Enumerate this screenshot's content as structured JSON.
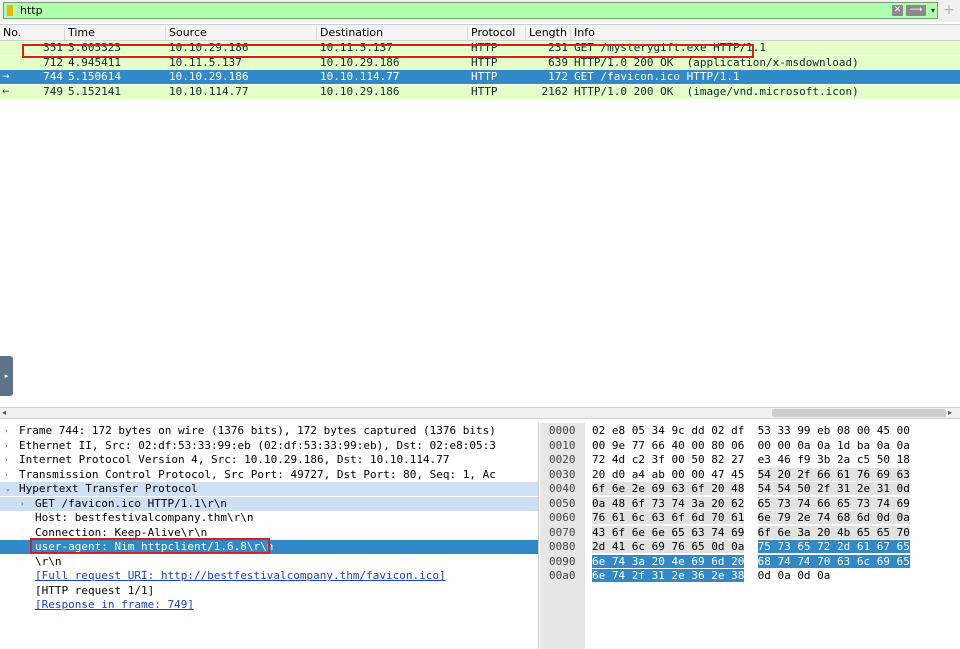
{
  "filter": {
    "value": "http",
    "clear_glyph": "✕",
    "apply_glyph": "⟶",
    "dropdown_glyph": "▾",
    "add_glyph": "+"
  },
  "packet_list": {
    "columns": [
      "No.",
      "Time",
      "Source",
      "Destination",
      "Protocol",
      "Length",
      "Info"
    ],
    "rows": [
      {
        "no": "351",
        "time": "3.605323",
        "source": "10.10.29.186",
        "destination": "10.11.5.137",
        "protocol": "HTTP",
        "length": "231",
        "info": "GET /mysterygift.exe HTTP/1.1",
        "marker": ""
      },
      {
        "no": "712",
        "time": "4.945411",
        "source": "10.11.5.137",
        "destination": "10.10.29.186",
        "protocol": "HTTP",
        "length": "639",
        "info": "HTTP/1.0 200 OK  (application/x-msdownload)",
        "marker": ""
      },
      {
        "no": "744",
        "time": "5.150614",
        "source": "10.10.29.186",
        "destination": "10.10.114.77",
        "protocol": "HTTP",
        "length": "172",
        "info": "GET /favicon.ico HTTP/1.1",
        "marker": "→"
      },
      {
        "no": "749",
        "time": "5.152141",
        "source": "10.10.114.77",
        "destination": "10.10.29.186",
        "protocol": "HTTP",
        "length": "2162",
        "info": "HTTP/1.0 200 OK  (image/vnd.microsoft.icon)",
        "marker": "←"
      }
    ],
    "selected_row": 2
  },
  "details": {
    "rows": [
      {
        "text": "Frame 744: 172 bytes on wire (1376 bits), 172 bytes captured (1376 bits)",
        "indent": 0,
        "twisty": "›",
        "style": "",
        "link": false
      },
      {
        "text": "Ethernet II, Src: 02:df:53:33:99:eb (02:df:53:33:99:eb), Dst: 02:e8:05:3",
        "indent": 0,
        "twisty": "›",
        "style": "",
        "link": false
      },
      {
        "text": "Internet Protocol Version 4, Src: 10.10.29.186, Dst: 10.10.114.77",
        "indent": 0,
        "twisty": "›",
        "style": "",
        "link": false
      },
      {
        "text": "Transmission Control Protocol, Src Port: 49727, Dst Port: 80, Seq: 1, Ac",
        "indent": 0,
        "twisty": "›",
        "style": "",
        "link": false
      },
      {
        "text": "Hypertext Transfer Protocol",
        "indent": 0,
        "twisty": "⌄",
        "style": "section",
        "link": false
      },
      {
        "text": "GET /favicon.ico HTTP/1.1\\r\\n",
        "indent": 1,
        "twisty": "›",
        "style": "section",
        "link": false
      },
      {
        "text": "Host: bestfestivalcompany.thm\\r\\n",
        "indent": 1,
        "twisty": "",
        "style": "",
        "link": false
      },
      {
        "text": "Connection: Keep-Alive\\r\\n",
        "indent": 1,
        "twisty": "",
        "style": "",
        "link": false
      },
      {
        "text": "user-agent: Nim httpclient/1.6.8\\r\\n",
        "indent": 1,
        "twisty": "",
        "style": "selected",
        "link": false
      },
      {
        "text": "\\r\\n",
        "indent": 1,
        "twisty": "",
        "style": "",
        "link": false
      },
      {
        "text": "[Full request URI: http://bestfestivalcompany.thm/favicon.ico]",
        "indent": 1,
        "twisty": "",
        "style": "",
        "link": true
      },
      {
        "text": "[HTTP request 1/1]",
        "indent": 1,
        "twisty": "",
        "style": "",
        "link": false
      },
      {
        "text": "[Response in frame: 749]",
        "indent": 1,
        "twisty": "",
        "style": "",
        "link": true
      }
    ]
  },
  "bytes": {
    "rows": [
      {
        "offset": "0000",
        "hex1": "02 e8 05 34 9c dd 02 df",
        "hex2": "53 33 99 eb 08 00 45 00"
      },
      {
        "offset": "0010",
        "hex1": "00 9e 77 66 40 00 80 06",
        "hex2": "00 00 0a 0a 1d ba 0a 0a"
      },
      {
        "offset": "0020",
        "hex1": "72 4d c2 3f 00 50 82 27",
        "hex2": "e3 46 f9 3b 2a c5 50 18"
      },
      {
        "offset": "0030",
        "hex1": "20 d0 a4 ab 00 00 47 45",
        "hex2": "54 20 2f 66 61 76 69 63"
      },
      {
        "offset": "0040",
        "hex1": "6f 6e 2e 69 63 6f 20 48",
        "hex2": "54 54 50 2f 31 2e 31 0d"
      },
      {
        "offset": "0050",
        "hex1": "0a 48 6f 73 74 3a 20 62",
        "hex2": "65 73 74 66 65 73 74 69"
      },
      {
        "offset": "0060",
        "hex1": "76 61 6c 63 6f 6d 70 61",
        "hex2": "6e 79 2e 74 68 6d 0d 0a"
      },
      {
        "offset": "0070",
        "hex1": "43 6f 6e 6e 65 63 74 69",
        "hex2": "6f 6e 3a 20 4b 65 65 70"
      },
      {
        "offset": "0080",
        "hex1": "2d 41 6c 69 76 65 0d 0a",
        "hex2": "75 73 65 72 2d 61 67 65"
      },
      {
        "offset": "0090",
        "hex1": "6e 74 3a 20 4e 69 6d 20",
        "hex2": "68 74 74 70 63 6c 69 65"
      },
      {
        "offset": "00a0",
        "hex1": "6e 74 2f 31 2e 36 2e 38",
        "hex2": "0d 0a 0d 0a"
      }
    ]
  }
}
